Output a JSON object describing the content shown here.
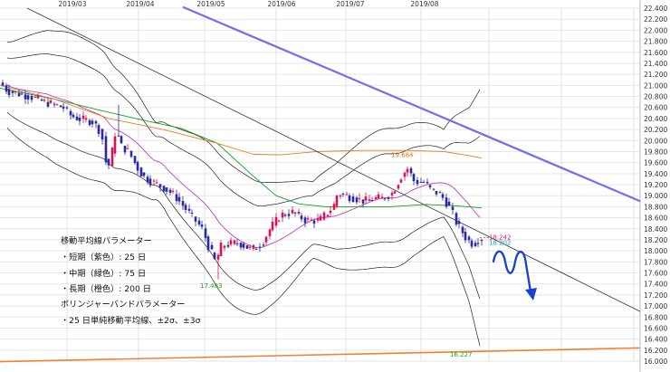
{
  "chart_data": {
    "type": "candlestick",
    "x_labels": [
      "2019/03",
      "2019/04",
      "2019/05",
      "2019/06",
      "2019/07",
      "2019/08"
    ],
    "y_ticks": [
      "22.400",
      "22.200",
      "22.000",
      "21.800",
      "21.600",
      "21.400",
      "21.200",
      "21.000",
      "20.800",
      "20.600",
      "20.400",
      "20.200",
      "20.000",
      "19.800",
      "19.600",
      "19.400",
      "19.200",
      "19.000",
      "18.800",
      "18.600",
      "18.400",
      "18.200",
      "18.000",
      "17.800",
      "17.600",
      "17.400",
      "17.200",
      "17.000",
      "16.800",
      "16.600",
      "16.400",
      "16.200",
      "16.000"
    ],
    "ylim": [
      16.0,
      22.4
    ],
    "grid": true,
    "annotations": [
      {
        "text": "17.483",
        "value": 17.483,
        "color": "#18a818"
      },
      {
        "text": "19.684",
        "value": 19.684,
        "color": "#e07000"
      },
      {
        "text": "16.227",
        "value": 16.227,
        "color": "#18a818"
      },
      {
        "text": "18.242",
        "value": 18.242,
        "color": "#e0206a"
      },
      {
        "text": "18.202",
        "value": 18.202,
        "color": "#14a0c8"
      }
    ],
    "legend": [
      "移動平均線パラメーター",
      "・短期（紫色）: 25 日",
      "・中期（緑色）: 75 日",
      "・長期（橙色）: 200 日",
      "ボリンジャーバンドパラメーター",
      "・25 日単純移動平均線、±2σ、±3σ"
    ],
    "series_colors": {
      "up": "#d4145a",
      "down": "#2a2a9c",
      "sma_short": "#c040c0",
      "sma_mid": "#10a020",
      "sma_long": "#e08020",
      "bands": "#222222",
      "trend_upper": "#7070e8",
      "trend_lower": "#f08030",
      "trend_mid": "#333333",
      "forecast_arrow": "#1a40d0",
      "last_line": "#e0206a"
    }
  }
}
